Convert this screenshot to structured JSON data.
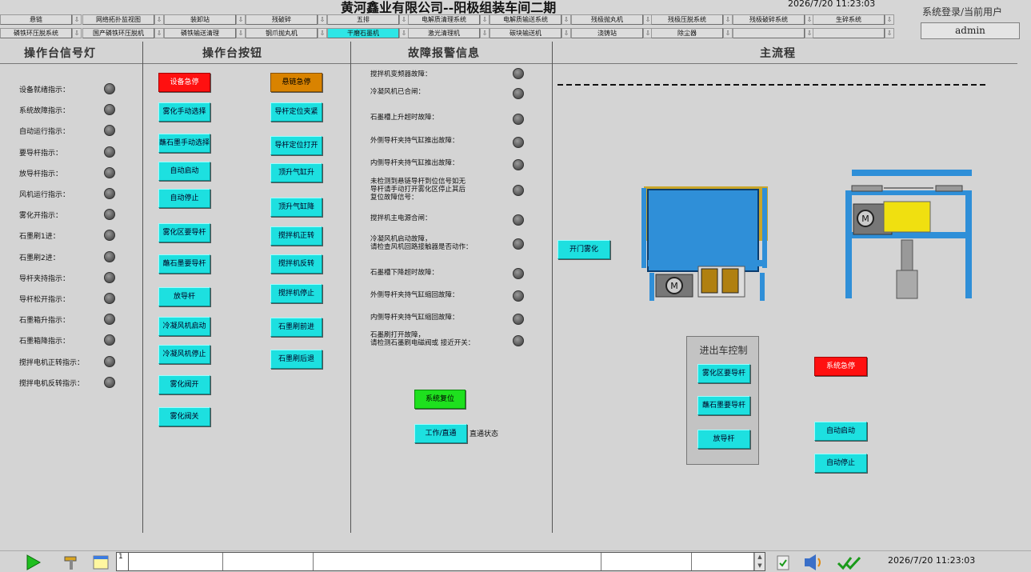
{
  "header": {
    "title": "黄河鑫业有限公司--阳极组装车间二期",
    "datetime": "2026/7/20 11:23:03",
    "login_label": "系统登录/当前用户",
    "user": "admin"
  },
  "nav_row1": [
    "悬链",
    "网络拓扑监视图",
    "装卸站",
    "残破碎",
    "五排",
    "电解质清理系统",
    "电解质输送系统",
    "残极抛丸机",
    "残极压脱系统",
    "残极破碎系统",
    "生碎系统"
  ],
  "nav_row2": [
    "磷铁环压脱系统",
    "国产磷铁环压脱机",
    "磷铁输送清理",
    "钢爪抛丸机",
    "干磨石墨机",
    "激光清理机",
    "碳块输送机",
    "浇铸站",
    "除尘器",
    "",
    ""
  ],
  "nav_active": "干磨石墨机",
  "panels": {
    "signals": "操作台信号灯",
    "buttons": "操作台按钮",
    "faults": "故障报警信息",
    "main": "主流程"
  },
  "signals": [
    "设备就绪指示：",
    "系统故障指示：",
    "自动运行指示：",
    "要导杆指示：",
    "放导杆指示：",
    "风机运行指示：",
    "雾化开指示：",
    "石墨刷1进：",
    "石墨刷2进：",
    "导杆夹持指示：",
    "导杆松开指示：",
    "石墨箱升指示：",
    "石墨箱降指示：",
    "搅拌电机正转指示：",
    "搅拌电机反转指示："
  ],
  "buttons_left": [
    "设备急停",
    "雾化手动选择",
    "蘸石墨手动选择",
    "自动启动",
    "自动停止",
    "雾化区要导杆",
    "蘸石墨要导杆",
    "放导杆",
    "冷凝风机启动",
    "冷凝风机停止",
    "雾化阀开",
    "雾化阀关"
  ],
  "buttons_right": [
    "悬链急停",
    "导杆定位夹紧",
    "导杆定位打开",
    "顶升气缸升",
    "顶升气缸降",
    "搅拌机正转",
    "搅拌机反转",
    "搅拌机停止",
    "石墨刷前进",
    "石墨刷后退"
  ],
  "faults": [
    "搅拌机变频器故障：",
    "冷凝风机已合闸：",
    "石墨槽上升超时故障：",
    "外侧导杆夹持气缸推出故障：",
    "内侧导杆夹持气缸推出故障：",
    "未检测到悬链导杆到位信号如无\n导杆请手动打开雾化区停止其后\n复位故障信号：",
    "搅拌机主电源合闸：",
    "冷凝风机启动故障，\n请检查风机回路接触器是否动作：",
    "石墨槽下降超时故障：",
    "外侧导杆夹持气缸缩回故障：",
    "内侧导杆夹持气缸缩回故障：",
    "石墨刷打开故障，\n请检测石墨刷电磁阀或 接近开关："
  ],
  "system_reset": "系统复位",
  "work_mode": "工作/直通",
  "work_status": "直通状态",
  "main_flow": {
    "open_mist": "开门雾化",
    "car_control_title": "进出车控制",
    "car_buttons": [
      "雾化区要导杆",
      "蘸石墨要导杆",
      "放导杆"
    ],
    "system_estop": "系统急停",
    "auto_start": "自动启动",
    "auto_stop": "自动停止",
    "motor_label": "M"
  },
  "bottom": {
    "msg_index": "1",
    "datetime": "2026/7/20 11:23:03"
  },
  "colors": {
    "cyan_button": "#1de0e0",
    "estop_red": "#ff1010",
    "chain_orange": "#d98300",
    "reset_green": "#1ee01e",
    "machine_blue": "#2f8fd8"
  }
}
